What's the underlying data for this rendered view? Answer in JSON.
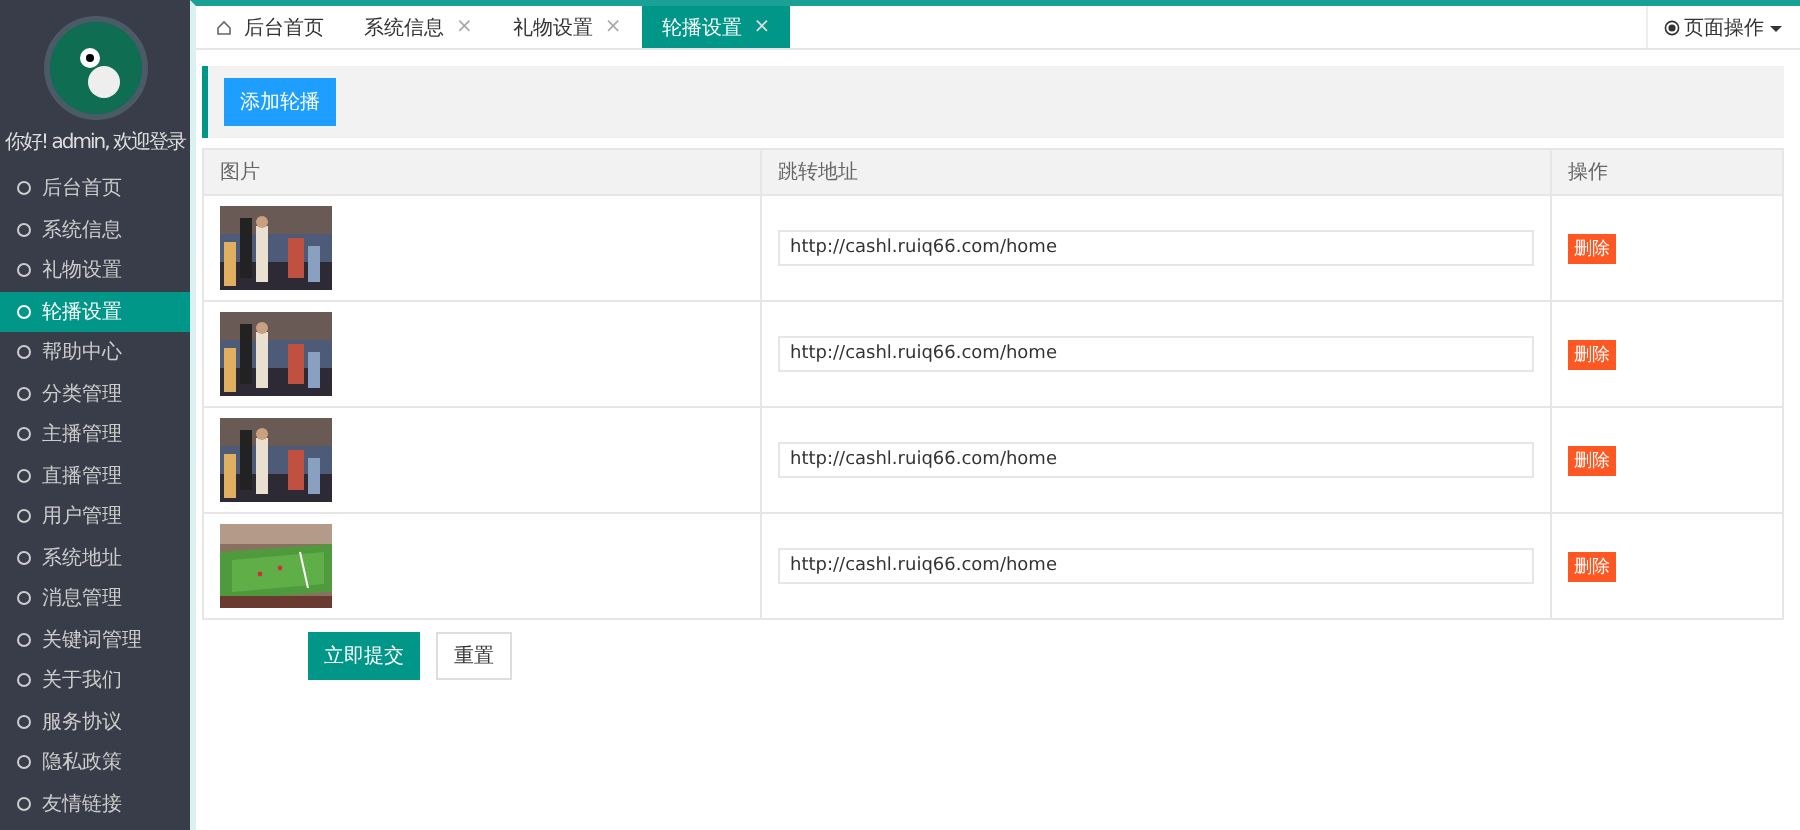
{
  "sidebar": {
    "greeting": "你好! admin, 欢迎登录",
    "items": [
      {
        "label": "后台首页",
        "selected": false
      },
      {
        "label": "系统信息",
        "selected": false
      },
      {
        "label": "礼物设置",
        "selected": false
      },
      {
        "label": "轮播设置",
        "selected": true
      },
      {
        "label": "帮助中心",
        "selected": false
      },
      {
        "label": "分类管理",
        "selected": false
      },
      {
        "label": "主播管理",
        "selected": false
      },
      {
        "label": "直播管理",
        "selected": false
      },
      {
        "label": "用户管理",
        "selected": false
      },
      {
        "label": "系统地址",
        "selected": false
      },
      {
        "label": "消息管理",
        "selected": false
      },
      {
        "label": "关键词管理",
        "selected": false
      },
      {
        "label": "关于我们",
        "selected": false
      },
      {
        "label": "服务协议",
        "selected": false
      },
      {
        "label": "隐私政策",
        "selected": false
      },
      {
        "label": "友情链接",
        "selected": false
      }
    ]
  },
  "tabs": [
    {
      "label": "后台首页",
      "closable": false,
      "selected": false
    },
    {
      "label": "系统信息",
      "closable": true,
      "selected": false
    },
    {
      "label": "礼物设置",
      "closable": true,
      "selected": false
    },
    {
      "label": "轮播设置",
      "closable": true,
      "selected": true
    }
  ],
  "close_mark": "×",
  "page_menu": "页面操作",
  "add_button": "添加轮播",
  "table": {
    "columns": [
      "图片",
      "跳转地址",
      "操作"
    ],
    "rows": [
      {
        "url": "http://cashl.ruiq66.com/home",
        "action": "删除"
      },
      {
        "url": "http://cashl.ruiq66.com/home",
        "action": "删除"
      },
      {
        "url": "http://cashl.ruiq66.com/home",
        "action": "删除"
      },
      {
        "url": "http://cashl.ruiq66.com/home",
        "action": "删除"
      }
    ]
  },
  "buttons": {
    "submit": "立即提交",
    "reset": "重置"
  }
}
